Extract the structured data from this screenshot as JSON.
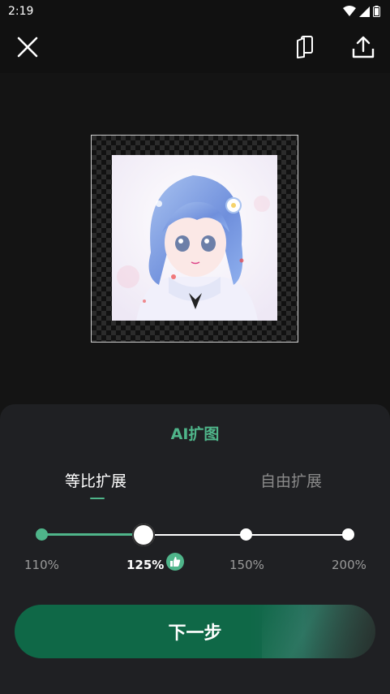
{
  "status_bar": {
    "time": "2:19"
  },
  "toolbar": {
    "close_icon": "close-icon",
    "compare_icon": "compare-icon",
    "share_icon": "share-icon"
  },
  "panel": {
    "title": "AI扩图",
    "tabs": [
      {
        "label": "等比扩展",
        "selected": true
      },
      {
        "label": "自由扩展",
        "selected": false
      }
    ],
    "scale_options": [
      "110%",
      "125%",
      "150%",
      "200%"
    ],
    "selected_scale": "125%",
    "recommended_icon": "thumbs-up-icon",
    "next_button": "下一步"
  },
  "colors": {
    "accent": "#4fb58a",
    "button": "#0f6847",
    "background": "#141414",
    "panel": "#1f2023"
  }
}
